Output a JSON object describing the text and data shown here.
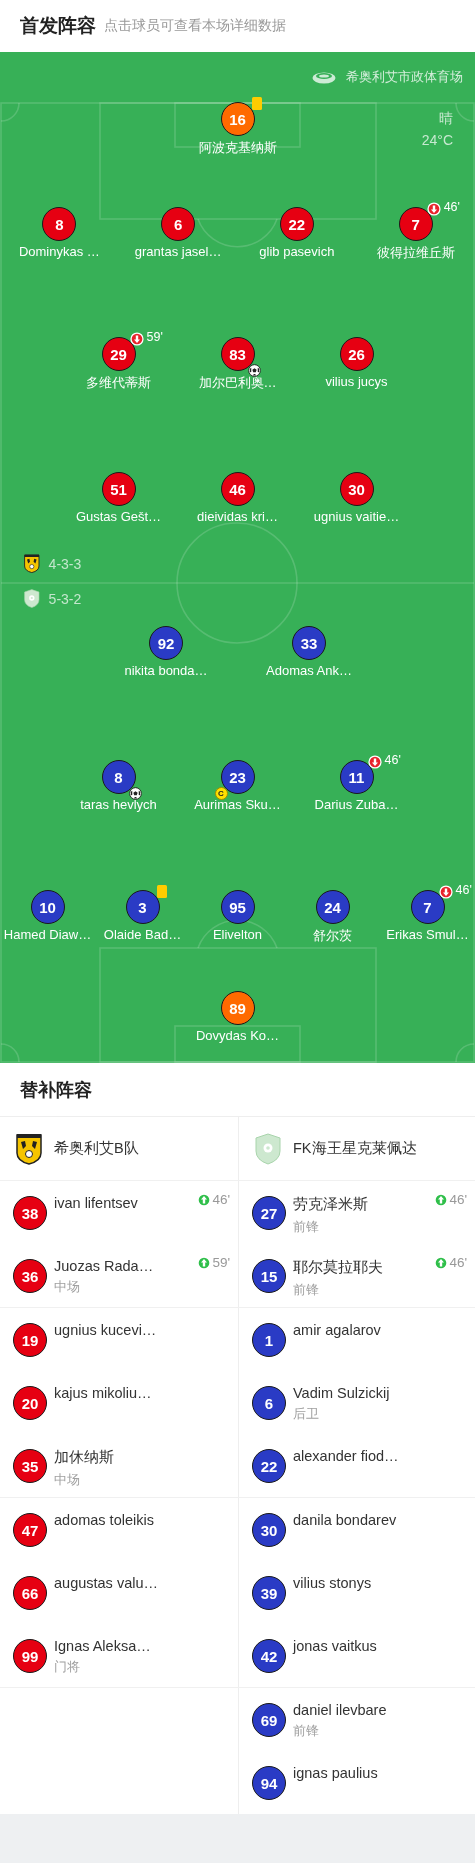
{
  "header": {
    "title": "首发阵容",
    "subtitle": "点击球员可查看本场详细数据"
  },
  "pitch": {
    "stadium": "希奥利艾市政体育场",
    "weather": "晴",
    "temperature": "24°C",
    "formations": [
      {
        "kind": "home",
        "label": "4-3-3"
      },
      {
        "kind": "away",
        "label": "5-3-2"
      }
    ],
    "rows": [
      {
        "kind": "home",
        "players": [
          {
            "number": "16",
            "name": "阿波克基纳斯",
            "kind": "goalkeeper",
            "events": [
              {
                "kind": "yellow_card"
              }
            ]
          }
        ]
      },
      {
        "kind": "home",
        "players": [
          {
            "number": "8",
            "name": "Dominykas …",
            "kind": "outfield"
          },
          {
            "number": "6",
            "name": "grantas jasel…",
            "kind": "outfield"
          },
          {
            "number": "22",
            "name": "glib pasevich",
            "kind": "outfield"
          },
          {
            "number": "7",
            "name": "彼得拉维丘斯",
            "kind": "outfield",
            "events": [
              {
                "kind": "sub_off",
                "minute": "46'"
              }
            ]
          }
        ]
      },
      {
        "kind": "home",
        "players": [
          {
            "number": "29",
            "name": "多维代蒂斯",
            "kind": "outfield",
            "events": [
              {
                "kind": "sub_off",
                "minute": "59'"
              }
            ]
          },
          {
            "number": "83",
            "name": "加尔巴利奥…",
            "kind": "outfield",
            "events": [
              {
                "kind": "goal"
              }
            ]
          },
          {
            "number": "26",
            "name": "vilius jucys",
            "kind": "outfield"
          }
        ]
      },
      {
        "kind": "home",
        "players": [
          {
            "number": "51",
            "name": "Gustas Gešt…",
            "kind": "outfield"
          },
          {
            "number": "46",
            "name": "dieividas kri…",
            "kind": "outfield"
          },
          {
            "number": "30",
            "name": "ugnius vaitie…",
            "kind": "outfield"
          }
        ]
      },
      {
        "kind": "away",
        "players": [
          {
            "number": "92",
            "name": "nikita bonda…",
            "kind": "outfield"
          },
          {
            "number": "33",
            "name": "Adomas Ank…",
            "kind": "outfield"
          }
        ]
      },
      {
        "kind": "away",
        "players": [
          {
            "number": "8",
            "name": "taras hevlych",
            "kind": "outfield",
            "events": [
              {
                "kind": "goal"
              }
            ]
          },
          {
            "number": "23",
            "name": "Aurimas Sku…",
            "kind": "outfield",
            "events": [
              {
                "kind": "captain",
                "label": "C"
              }
            ]
          },
          {
            "number": "11",
            "name": "Darius Zuba…",
            "kind": "outfield",
            "events": [
              {
                "kind": "sub_off",
                "minute": "46'"
              }
            ]
          }
        ]
      },
      {
        "kind": "away",
        "players": [
          {
            "number": "10",
            "name": "Hamed Diaw…",
            "kind": "outfield"
          },
          {
            "number": "3",
            "name": "Olaide Bad…",
            "kind": "outfield",
            "events": [
              {
                "kind": "yellow_card"
              }
            ]
          },
          {
            "number": "95",
            "name": "Elivelton",
            "kind": "outfield"
          },
          {
            "number": "24",
            "name": "舒尔茨",
            "kind": "outfield"
          },
          {
            "number": "7",
            "name": "Erikas Smul…",
            "kind": "outfield",
            "events": [
              {
                "kind": "sub_off",
                "minute": "46'"
              }
            ]
          }
        ]
      },
      {
        "kind": "away",
        "players": [
          {
            "number": "89",
            "name": "Dovydas Ko…",
            "kind": "goalkeeper"
          }
        ]
      }
    ]
  },
  "bench": {
    "title": "替补阵容",
    "teams": [
      {
        "kind": "home",
        "name": "希奥利艾B队"
      },
      {
        "kind": "away",
        "name": "FK海王星克莱佩达"
      }
    ],
    "groups": [
      {
        "home": [
          {
            "number": "38",
            "name": "ivan lifentsev",
            "subbed_on": "46'"
          },
          {
            "number": "36",
            "name": "Juozas Rada…",
            "position": "中场",
            "subbed_on": "59'"
          }
        ],
        "away": [
          {
            "number": "27",
            "name": "劳克泽米斯",
            "position": "前锋",
            "subbed_on": "46'"
          },
          {
            "number": "15",
            "name": "耶尔莫拉耶夫",
            "position": "前锋",
            "subbed_on": "46'"
          }
        ]
      },
      {
        "home": [
          {
            "number": "19",
            "name": "ugnius kucevi…"
          },
          {
            "number": "20",
            "name": "kajus mikoliu…"
          },
          {
            "number": "35",
            "name": "加休纳斯",
            "position": "中场"
          }
        ],
        "away": [
          {
            "number": "1",
            "name": "amir agalarov"
          },
          {
            "number": "6",
            "name": "Vadim Sulzickij",
            "position": "后卫"
          },
          {
            "number": "22",
            "name": "alexander fiod…"
          }
        ]
      },
      {
        "home": [
          {
            "number": "47",
            "name": "adomas toleikis"
          },
          {
            "number": "66",
            "name": "augustas valu…"
          },
          {
            "number": "99",
            "name": "Ignas Aleksa…",
            "position": "门将"
          }
        ],
        "away": [
          {
            "number": "30",
            "name": "danila bondarev"
          },
          {
            "number": "39",
            "name": "vilius stonys"
          },
          {
            "number": "42",
            "name": "jonas vaitkus"
          }
        ]
      },
      {
        "away": [
          {
            "number": "69",
            "name": "daniel ilevbare",
            "position": "前锋"
          },
          {
            "number": "94",
            "name": "ignas paulius"
          }
        ]
      }
    ]
  }
}
